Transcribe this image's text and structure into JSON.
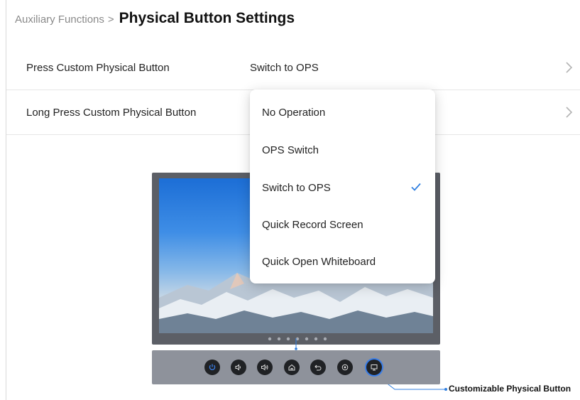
{
  "header": {
    "breadcrumb": "Auxiliary Functions",
    "separator": ">",
    "title": "Physical Button Settings"
  },
  "settings": [
    {
      "label": "Press Custom Physical Button",
      "value": "Switch to OPS"
    },
    {
      "label": "Long Press Custom Physical Button",
      "value": ""
    }
  ],
  "dropdown": {
    "options": [
      {
        "label": "No Operation",
        "selected": false
      },
      {
        "label": "OPS Switch",
        "selected": false
      },
      {
        "label": "Switch to OPS",
        "selected": true
      },
      {
        "label": "Quick Record Screen",
        "selected": false
      },
      {
        "label": "Quick Open Whiteboard",
        "selected": false
      }
    ]
  },
  "illustration": {
    "callout_label": "Customizable Physical Button",
    "panel_buttons": [
      "power-icon",
      "volume-down-icon",
      "volume-up-icon",
      "home-icon",
      "back-icon",
      "settings-icon",
      "screen-icon"
    ]
  },
  "colors": {
    "accent": "#2f7fe0",
    "selected_button_ring": "#3a7ee8",
    "panel": "#8e929b",
    "bezel": "#5c5f66"
  }
}
